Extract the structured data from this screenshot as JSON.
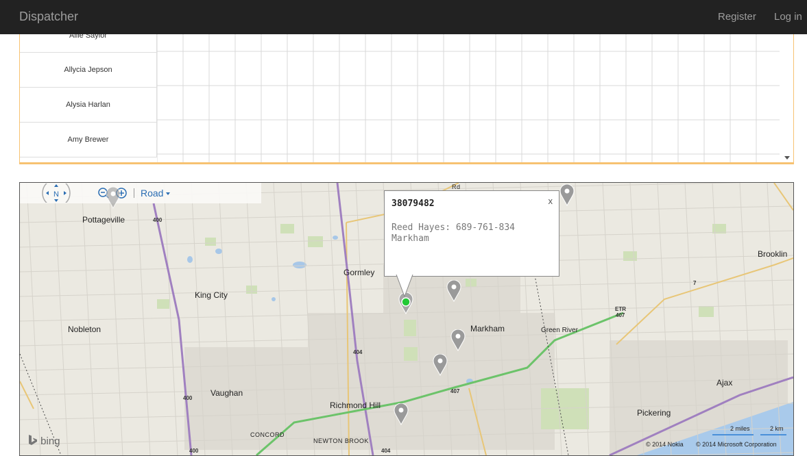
{
  "navbar": {
    "brand": "Dispatcher",
    "register": "Register",
    "login": "Log in"
  },
  "schedule": {
    "names": [
      "Allie Saylor",
      "Allycia Jepson",
      "Alysia Harlan",
      "Amy Brewer"
    ]
  },
  "map": {
    "toolbar": {
      "compass_label": "N",
      "road_label": "Road"
    },
    "places": {
      "pottageville": "Pottageville",
      "king_city": "King City",
      "nobleton": "Nobleton",
      "vaughan": "Vaughan",
      "gormley": "Gormley",
      "markham": "Markham",
      "green_river": "Green River",
      "brooklin": "Brooklin",
      "ajax": "Ajax",
      "pickering": "Pickering",
      "richmond_hill": "Richmond Hill",
      "concord": "CONCORD",
      "newton_brook": "NEWTON BROOK",
      "rd": "Rd"
    },
    "shields": {
      "s400a": "400",
      "s400b": "400",
      "s400c": "400",
      "s404a": "404",
      "s404b": "404",
      "s407a": "407",
      "s407b": "407",
      "s7": "7",
      "etr": "ETR"
    },
    "popup": {
      "title": "38079482",
      "line1": "Reed Hayes: 689-761-834",
      "line2": "Markham",
      "close": "x"
    },
    "bing": "bing",
    "scale_miles": "2 miles",
    "scale_km": "2 km",
    "copyright_nokia": "© 2014 Nokia",
    "copyright_ms": "© 2014 Microsoft Corporation"
  }
}
